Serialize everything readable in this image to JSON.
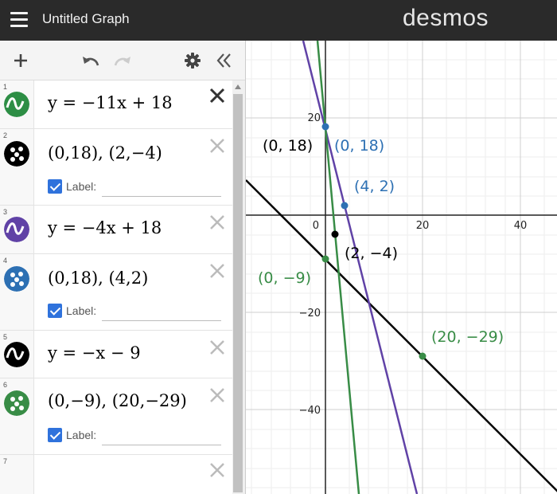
{
  "header": {
    "title": "Untitled Graph",
    "logo": "desmos"
  },
  "toolbar": {
    "add": "plus-icon",
    "undo": "undo-icon",
    "redo": "redo-icon",
    "settings": "gear-icon",
    "collapse": "double-chevron-left-icon"
  },
  "expressions": [
    {
      "num": "1",
      "color": "#2d8e45",
      "latex": "y = −11x + 18"
    },
    {
      "num": "2",
      "color": "#000000",
      "points": "(0,18), (2,−4)",
      "label": "Label:"
    },
    {
      "num": "3",
      "color": "#6042a6",
      "latex": "y = −4x + 18"
    },
    {
      "num": "4",
      "color": "#2d70b3",
      "points": "(0,18), (4,2)",
      "label": "Label:"
    },
    {
      "num": "5",
      "color": "#000000",
      "latex": "y = −x − 9"
    },
    {
      "num": "6",
      "color": "#388c46",
      "points": "(0,−9), (20,−29)",
      "label": "Label:"
    },
    {
      "num": "7"
    }
  ],
  "graph": {
    "colors": {
      "green": "#388c46",
      "purple": "#6042a6",
      "blue": "#2d70b3",
      "black": "#000000"
    },
    "x_ticks": [
      "0",
      "20",
      "40"
    ],
    "y_ticks": [
      "20",
      "−20",
      "−40"
    ],
    "point_labels": {
      "p018_black": "(0, 18)",
      "p018_blue": "(0, 18)",
      "p42": "(4, 2)",
      "p2m4": "(2, −4)",
      "p0m9": "(0, −9)",
      "p20m29": "(20, −29)"
    }
  }
}
